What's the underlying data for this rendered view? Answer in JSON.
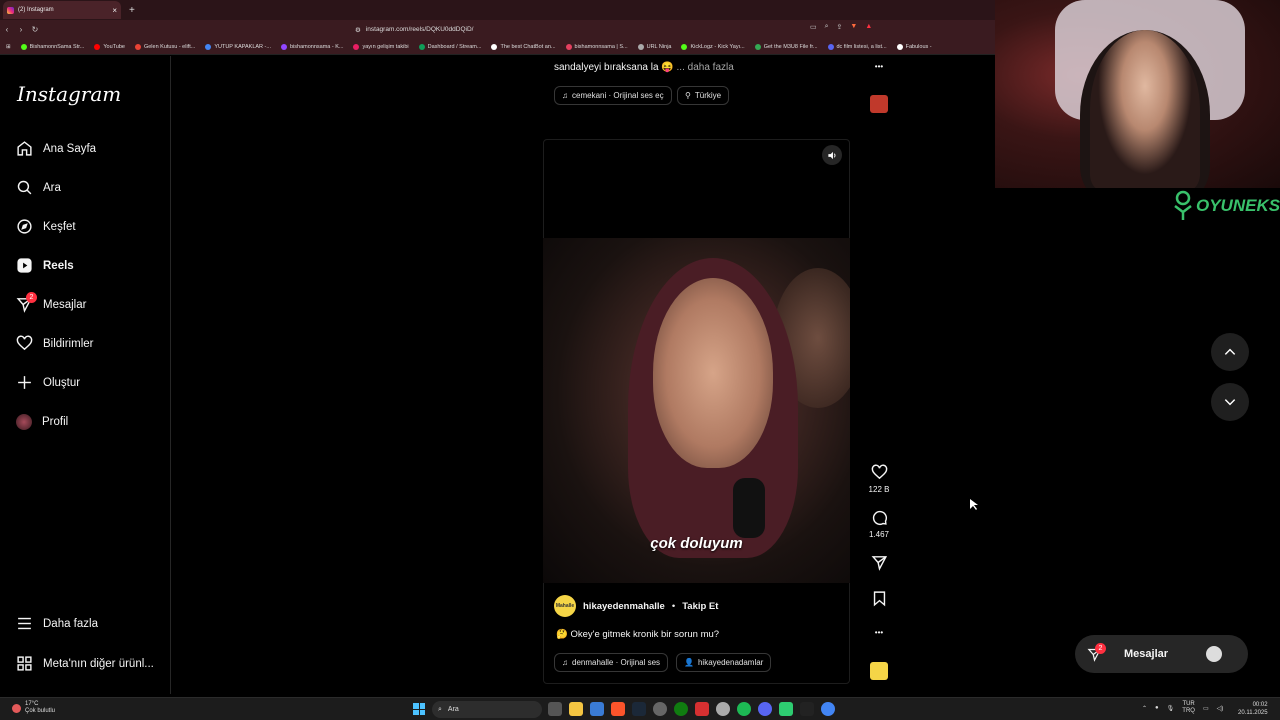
{
  "browser": {
    "tab_title": "(2) Instagram",
    "tab_close": "×",
    "new_tab": "+",
    "url": "instagram.com/reels/DQKU0ddDQiD/",
    "bookmarks": [
      "BishamonnSama Str...",
      "YouTube",
      "Gelen Kutusu - elift...",
      "YUTUP KAPAKLAR -...",
      "bishamonnsama - K...",
      "yayın gelişim takibi",
      "Dashboard / Stream...",
      "The best ChatBot an...",
      "bishamonnsama | S...",
      "URL Ninja",
      "KickLogz - Kick Yayı...",
      "Get the M3U8 File fr...",
      "dc film listesi, a list...",
      "Fabulous -"
    ]
  },
  "sidebar": {
    "logo": "Instagram",
    "items": [
      {
        "label": "Ana Sayfa"
      },
      {
        "label": "Ara"
      },
      {
        "label": "Keşfet"
      },
      {
        "label": "Reels"
      },
      {
        "label": "Mesajlar",
        "badge": "2"
      },
      {
        "label": "Bildirimler"
      },
      {
        "label": "Oluştur"
      },
      {
        "label": "Profil"
      },
      {
        "label": "Daha fazla"
      },
      {
        "label": "Meta'nın diğer ürünl..."
      }
    ]
  },
  "prev_post": {
    "caption": "sandalyeyi bıraksana la 😝",
    "more": "... daha fazla",
    "audio": "cemekani · Orijinal ses  eç",
    "location": "Türkiye"
  },
  "post": {
    "subtitle": "çok doluyum",
    "author": "hikayedenmahalle",
    "separator": "•",
    "follow": "Takip Et",
    "avatar_text": "Mahalle",
    "caption": "🤔 Okey'e gitmek kronik bir sorun mu?",
    "audio": "denmahalle · Orijinal ses",
    "tagged": "hikayedenadamlar",
    "likes": "122 B",
    "comments": "1.467"
  },
  "overlay": {
    "brand": "OYUNEKS"
  },
  "messages_pill": {
    "label": "Mesajlar",
    "badge": "2"
  },
  "taskbar": {
    "temp": "17°C",
    "weather": "Çok bulutlu",
    "search": "Ara",
    "lang1": "TUR",
    "lang2": "TRQ",
    "time": "00:02",
    "date": "20.11.2025"
  },
  "colors": {
    "badge": "#ff3040",
    "brand": "#39c16b",
    "browser_bg": "#3a1b20"
  }
}
